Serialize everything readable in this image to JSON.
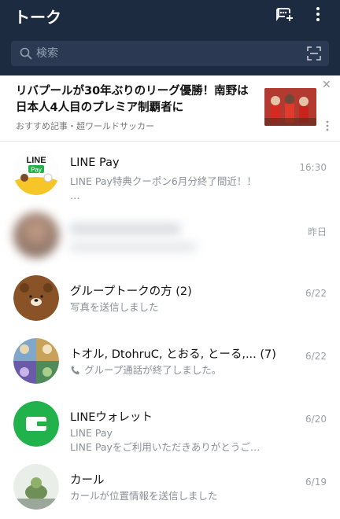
{
  "header": {
    "title": "トーク",
    "search_placeholder": "検索"
  },
  "ad": {
    "title": "リバプールが30年ぶりのリーグ優勝！南野は日本人4人目のプレミア制覇者に",
    "meta": "おすすめ記事・超ワールドサッカー"
  },
  "chats": [
    {
      "name": "LINE Pay",
      "time": "16:30",
      "message": "LINE Pay特典クーポン6月分終了間近！！",
      "message2": "…"
    },
    {
      "name": "",
      "time": "昨日",
      "message": ""
    },
    {
      "name": "グループトークの方 (2)",
      "time": "6/22",
      "message": "写真を送信しました"
    },
    {
      "name": "トオル, DtohruC, とおる, とーる,...  (7)",
      "time": "6/22",
      "message": "グループ通話が終了しました。"
    },
    {
      "name": "LINEウォレット",
      "time": "6/20",
      "message": "LINE Pay",
      "message2": "LINE Payをご利用いただきありがとうご…"
    },
    {
      "name": "カール",
      "time": "6/19",
      "message": "カールが位置情報を送信しました"
    }
  ],
  "colors": {
    "header_bg": "#1d2b40",
    "line_green": "#21b24b"
  },
  "icons": [
    "add-chat-icon",
    "more-vert-icon",
    "search-icon",
    "scan-icon",
    "close-icon",
    "phone-icon",
    "wallet-icon"
  ]
}
